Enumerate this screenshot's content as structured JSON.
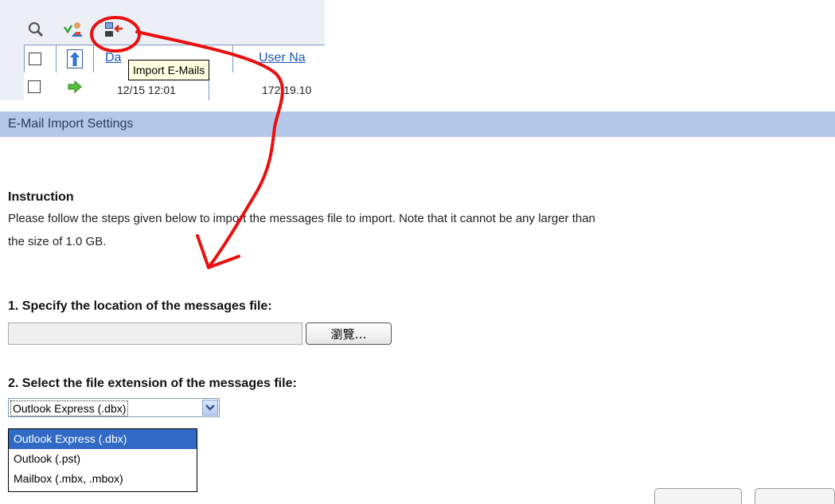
{
  "grid": {
    "columns": [
      "Da",
      "User Na"
    ],
    "row": {
      "date": "12/15 12:01",
      "user": "172.19.10"
    }
  },
  "tooltip": {
    "text": "Import E-Mails"
  },
  "dialog": {
    "title": "E-Mail Import Settings",
    "instruction_heading": "Instruction",
    "instruction_line1": "Please follow the steps given below to import the messages file to import. Note that it cannot be any larger than",
    "instruction_line2": "the size of 1.0 GB.",
    "step1_label": "1. Specify the location of the messages file:",
    "file_input_value": "",
    "browse_label": "瀏覽…",
    "step2_label": "2. Select the file extension of the messages file:",
    "selected_extension": "Outlook Express (.dbx)",
    "extension_options": [
      "Outlook Express (.dbx)",
      "Outlook (.pst)",
      "Mailbox (.mbx, .mbox)"
    ]
  },
  "icons": {
    "toolbar": [
      "search-icon",
      "user-refresh-icon",
      "import-email-icon"
    ],
    "grid": [
      "sort-up-arrow-icon",
      "row-go-arrow-icon"
    ]
  },
  "colors": {
    "titlebar_bg": "#b5c7e6",
    "selection_bg": "#316ac5",
    "tooltip_bg": "#ffffe1",
    "annotation_red": "#e81010"
  }
}
